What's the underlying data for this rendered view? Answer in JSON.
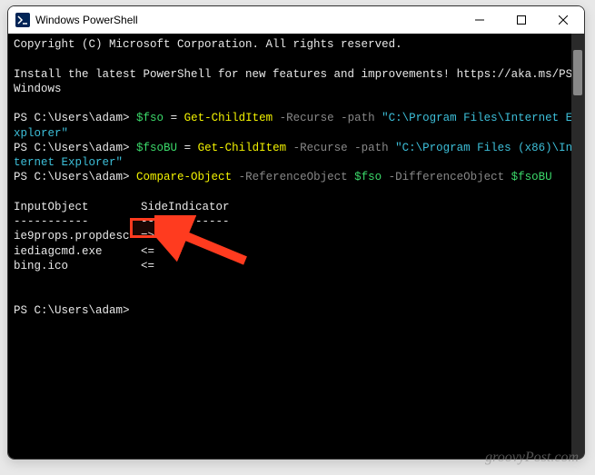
{
  "window": {
    "title": "Windows PowerShell"
  },
  "terminal": {
    "copyright": "Copyright (C) Microsoft Corporation. All rights reserved.",
    "install_msg": "Install the latest PowerShell for new features and improvements! https://aka.ms/PSWindows",
    "prompt": "PS C:\\Users\\adam>",
    "cmd1": {
      "var": "$fso",
      "eq": " = ",
      "cmd": "Get-ChildItem",
      "flags": " -Recurse -path ",
      "path": "\"C:\\Program Files\\Internet Explorer\""
    },
    "cmd2": {
      "var": "$fsoBU",
      "eq": " = ",
      "cmd": "Get-ChildItem",
      "flags": " -Recurse -path ",
      "path": "\"C:\\Program Files (x86)\\Internet Explorer\""
    },
    "cmd3": {
      "cmd": "Compare-Object",
      "flag1": " -ReferenceObject ",
      "var1": "$fso",
      "flag2": " -DifferenceObject ",
      "var2": "$fsoBU"
    },
    "headers": {
      "col1": "InputObject",
      "col2": "SideIndicator"
    },
    "dashes": {
      "col1": "-----------",
      "col2": "-------------"
    },
    "rows": [
      {
        "obj": "ie9props.propdesc",
        "ind": "=>"
      },
      {
        "obj": "iediagcmd.exe",
        "ind": "<="
      },
      {
        "obj": "bing.ico",
        "ind": "<="
      }
    ]
  },
  "watermark": "groovyPost.com"
}
